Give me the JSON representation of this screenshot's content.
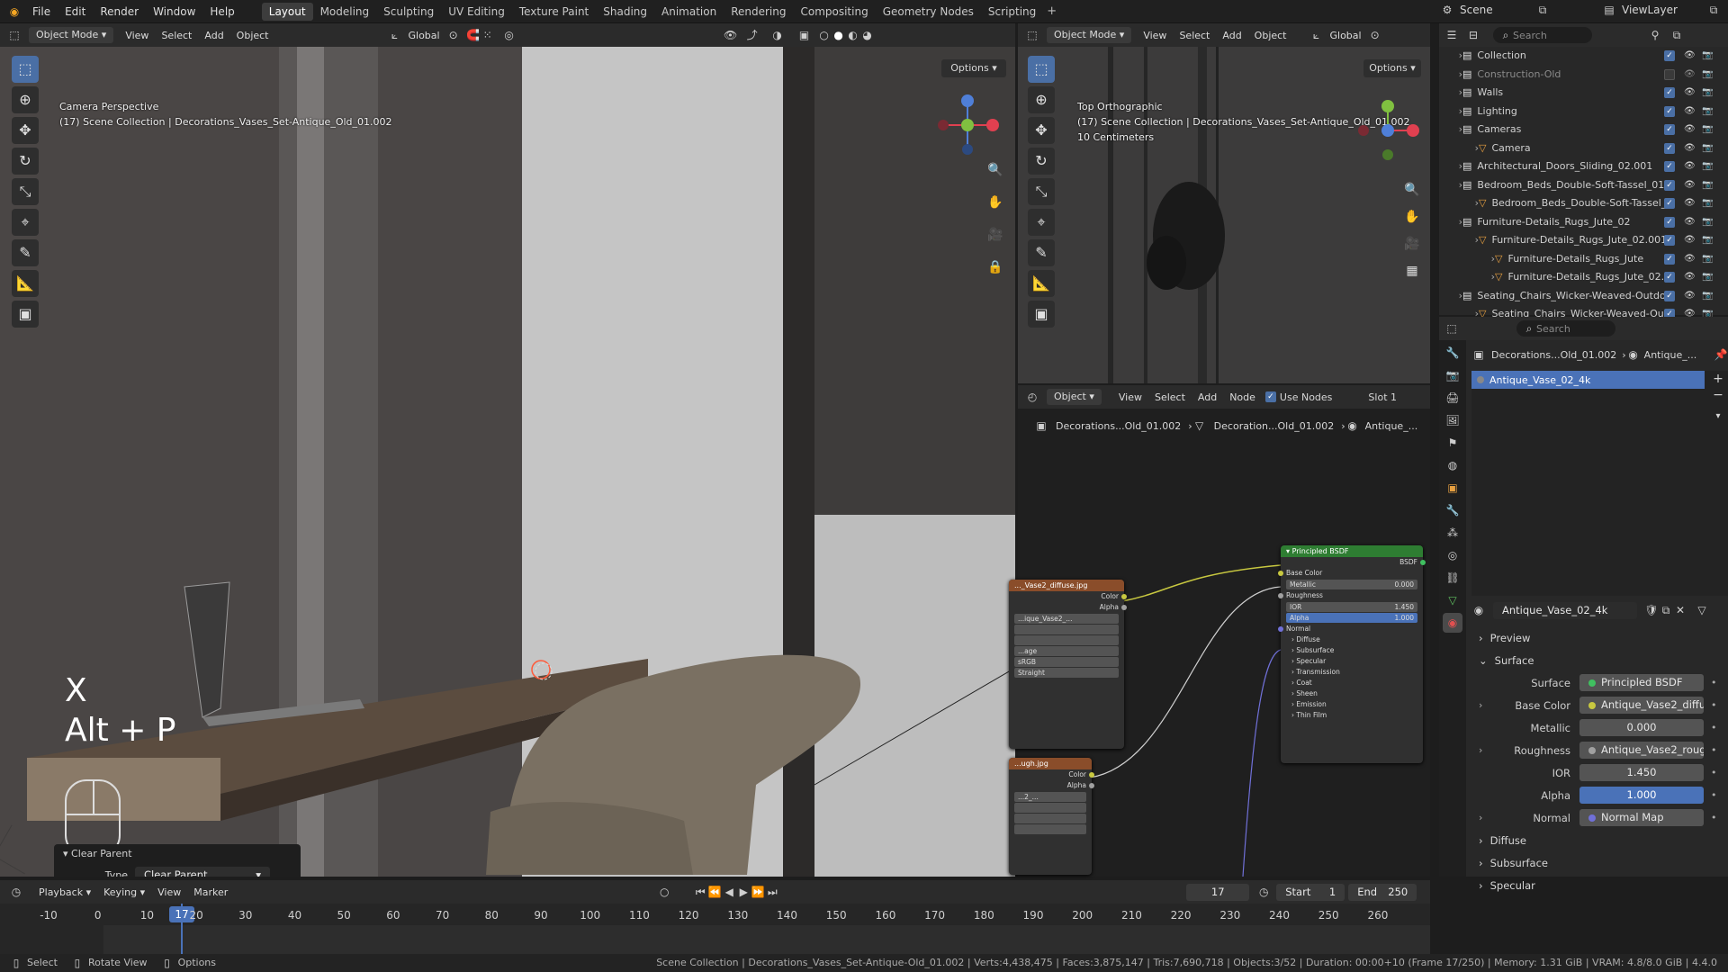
{
  "topbar": {
    "menus": [
      "File",
      "Edit",
      "Render",
      "Window",
      "Help"
    ],
    "workspaces": [
      "Layout",
      "Modeling",
      "Sculpting",
      "UV Editing",
      "Texture Paint",
      "Shading",
      "Animation",
      "Rendering",
      "Compositing",
      "Geometry Nodes",
      "Scripting"
    ],
    "active_workspace": "Layout",
    "scene_label": "Scene",
    "viewlayer_label": "ViewLayer"
  },
  "viewport_left": {
    "mode": "Object Mode",
    "menus": [
      "View",
      "Select",
      "Add",
      "Object"
    ],
    "transform": "Global",
    "options": "Options",
    "overlay_line1": "Camera Perspective",
    "overlay_line2": "(17) Scene Collection | Decorations_Vases_Set-Antique_Old_01.002",
    "key_hint_1": "X",
    "key_hint_2": "Alt + P",
    "operator_panel": {
      "title": "Clear Parent",
      "type_label": "Type",
      "type_value": "Clear Parent"
    },
    "gizmo": {
      "z": "Z",
      "y": "Y",
      "x": "X"
    }
  },
  "viewport_right": {
    "mode": "Object Mode",
    "menus": [
      "View",
      "Select",
      "Add",
      "Object"
    ],
    "transform": "Global",
    "options": "Options",
    "overlay_line1": "Top Orthographic",
    "overlay_line2": "(17) Scene Collection | Decorations_Vases_Set-Antique_Old_01.002",
    "overlay_line3": "10 Centimeters"
  },
  "node_editor": {
    "mode": "Object",
    "menus": [
      "View",
      "Select",
      "Add",
      "Node"
    ],
    "use_nodes": "Use Nodes",
    "slot": "Slot 1",
    "breadcrumb": [
      "Decorations...Old_01.002",
      "Decoration...Old_01.002",
      "Antique_..."
    ],
    "tex1": {
      "title": "..._Vase2_diffuse.jpg",
      "out1": "Color",
      "out2": "Alpha",
      "img": "...ique_Vase2_...",
      "cs": "sRGB",
      "alpha": "Straight",
      "ext": "...age"
    },
    "tex2": {
      "title": "...ugh.jpg",
      "out1": "Color",
      "out2": "Alpha",
      "img": "...2_..."
    },
    "bsdf": {
      "title": "Principled BSDF",
      "out": "BSDF",
      "base_color": "Base Color",
      "metallic": "Metallic",
      "metallic_v": "0.000",
      "roughness": "Roughness",
      "ior": "IOR",
      "ior_v": "1.450",
      "alpha": "Alpha",
      "alpha_v": "1.000",
      "normal": "Normal",
      "panels": [
        "Diffuse",
        "Subsurface",
        "Specular",
        "Transmission",
        "Coat",
        "Sheen",
        "Emission",
        "Thin Film"
      ]
    }
  },
  "outliner": {
    "search": "Search",
    "rows": [
      {
        "label": "Collection",
        "indent": 0,
        "dim": false
      },
      {
        "label": "Construction-Old",
        "indent": 0,
        "dim": true
      },
      {
        "label": "Walls",
        "indent": 0,
        "dim": false
      },
      {
        "label": "Lighting",
        "indent": 0,
        "dim": false
      },
      {
        "label": "Cameras",
        "indent": 0,
        "dim": false
      },
      {
        "label": "Camera",
        "indent": 1,
        "dim": false
      },
      {
        "label": "Architectural_Doors_Sliding_02.001",
        "indent": 0,
        "dim": false
      },
      {
        "label": "Bedroom_Beds_Double-Soft-Tassel_01.",
        "indent": 0,
        "dim": false
      },
      {
        "label": "Bedroom_Beds_Double-Soft-Tassel_",
        "indent": 1,
        "dim": false
      },
      {
        "label": "Furniture-Details_Rugs_Jute_02",
        "indent": 0,
        "dim": false
      },
      {
        "label": "Furniture-Details_Rugs_Jute_02.001",
        "indent": 1,
        "dim": false
      },
      {
        "label": "Furniture-Details_Rugs_Jute",
        "indent": 2,
        "dim": false
      },
      {
        "label": "Furniture-Details_Rugs_Jute_02.",
        "indent": 2,
        "dim": false
      },
      {
        "label": "Seating_Chairs_Wicker-Weaved-Outdo",
        "indent": 0,
        "dim": false
      },
      {
        "label": "Seating_Chairs_Wicker-Weaved-Ou",
        "indent": 1,
        "dim": false
      }
    ]
  },
  "properties": {
    "search": "Search",
    "breadcrumb_obj": "Decorations...Old_01.002",
    "breadcrumb_mat": "Antique_...",
    "slot_name": "Antique_Vase_02_4k",
    "material_name": "Antique_Vase_02_4k",
    "preview": "Preview",
    "surface_section": "Surface",
    "rows": {
      "surface": {
        "label": "Surface",
        "value": "Principled BSDF"
      },
      "base_color": {
        "label": "Base Color",
        "value": "Antique_Vase2_diffuse.j..."
      },
      "metallic": {
        "label": "Metallic",
        "value": "0.000"
      },
      "roughness": {
        "label": "Roughness",
        "value": "Antique_Vase2_rough.jpg"
      },
      "ior": {
        "label": "IOR",
        "value": "1.450"
      },
      "alpha": {
        "label": "Alpha",
        "value": "1.000"
      },
      "normal": {
        "label": "Normal",
        "value": "Normal Map"
      }
    },
    "subsections": [
      "Diffuse",
      "Subsurface",
      "Specular"
    ]
  },
  "timeline": {
    "menus": [
      "Playback",
      "Keying",
      "View",
      "Marker"
    ],
    "current_frame": "17",
    "start_label": "Start",
    "start": "1",
    "end_label": "End",
    "end": "250",
    "ticks": [
      "-10",
      "0",
      "10",
      "20",
      "30",
      "40",
      "50",
      "60",
      "70",
      "80",
      "90",
      "100",
      "110",
      "120",
      "130",
      "140",
      "150",
      "160",
      "170",
      "180",
      "190",
      "200",
      "210",
      "220",
      "230",
      "240",
      "250",
      "260"
    ]
  },
  "statusbar": {
    "left": [
      "Select",
      "Rotate View",
      "Options"
    ],
    "right": "Scene Collection | Decorations_Vases_Set-Antique-Old_01.002 | Verts:4,438,475 | Faces:3,875,147 | Tris:7,690,718 | Objects:3/52 | Duration: 00:00+10 (Frame 17/250) | Memory: 1.31 GiB | VRAM: 4.8/8.0 GiB | 4.4.0"
  }
}
